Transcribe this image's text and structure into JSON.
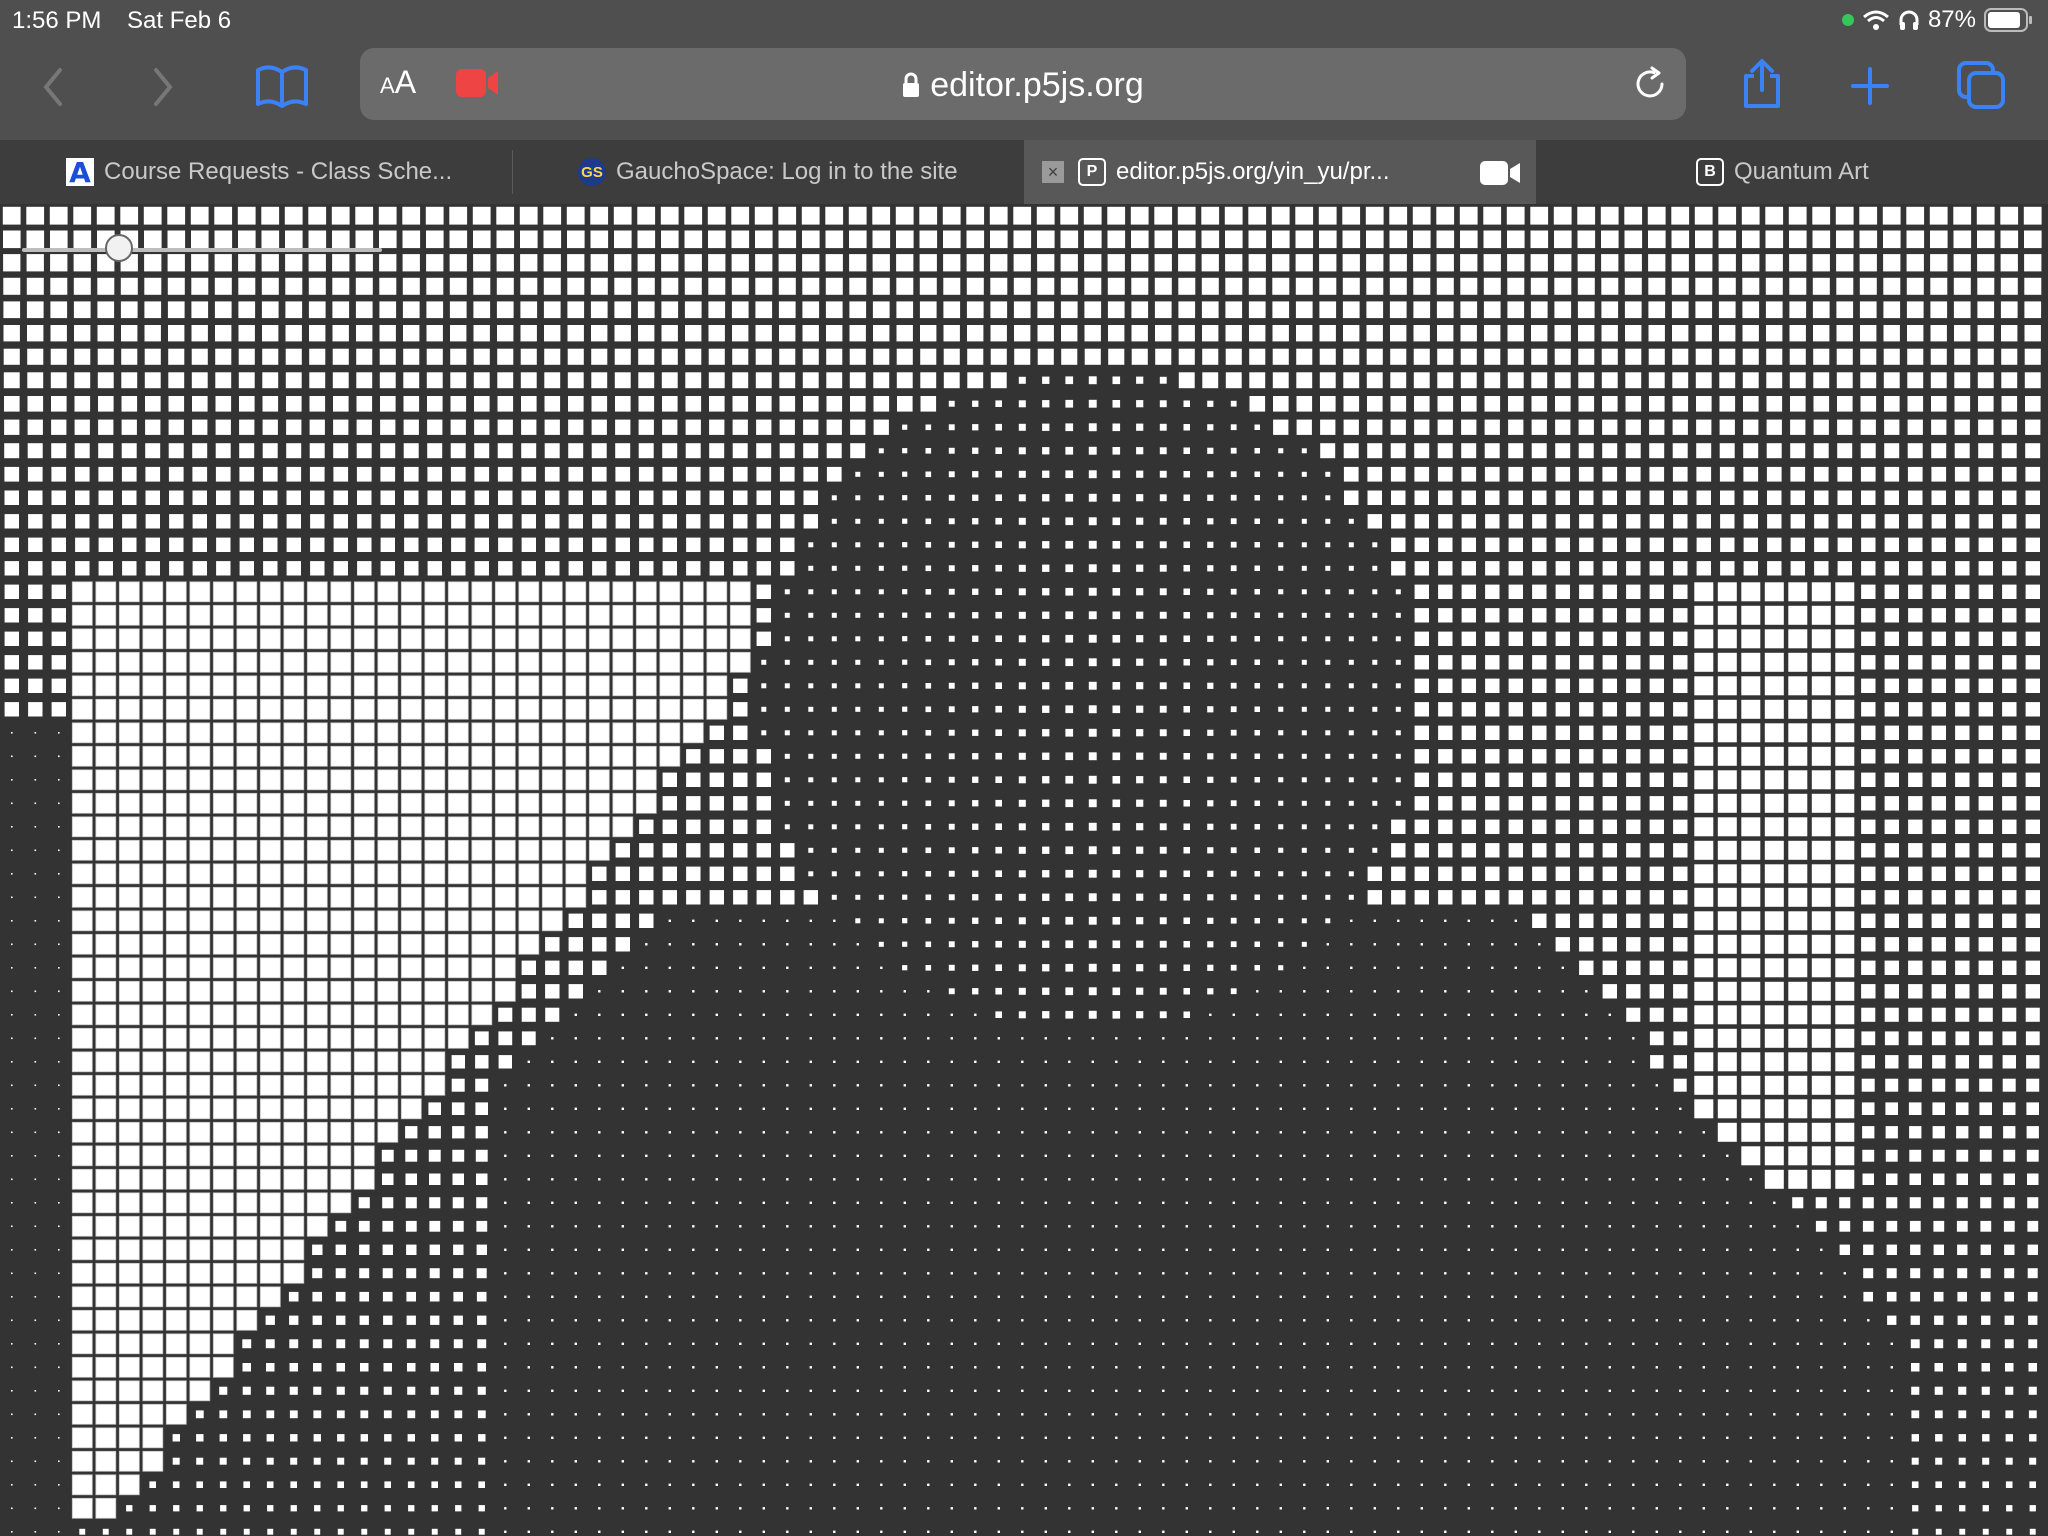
{
  "status_bar": {
    "time": "1:56 PM",
    "date": "Sat Feb 6",
    "battery": "87%",
    "icons": [
      "camera-in-use-dot",
      "wifi-icon",
      "headphones-icon",
      "battery-icon"
    ]
  },
  "toolbar": {
    "buttons": [
      "back-icon",
      "forward-icon",
      "bookmarks-icon",
      "share-icon",
      "new-tab-icon",
      "tabs-overview-icon"
    ],
    "reader_label": "AA",
    "url": "editor.p5js.org"
  },
  "tabs": [
    {
      "title": "Course Requests - Class Sche...",
      "favicon": "A",
      "active": false
    },
    {
      "title": "GauchoSpace: Log in to the site",
      "favicon": "GS",
      "active": false
    },
    {
      "title": "editor.p5js.org/yin_yu/pr...",
      "favicon": "P",
      "active": true
    },
    {
      "title": "Quantum Art",
      "favicon": "B",
      "active": false
    }
  ],
  "sketch": {
    "background_color": "#333333",
    "cell_color": "#ffffff",
    "slider_value": 0.25
  }
}
